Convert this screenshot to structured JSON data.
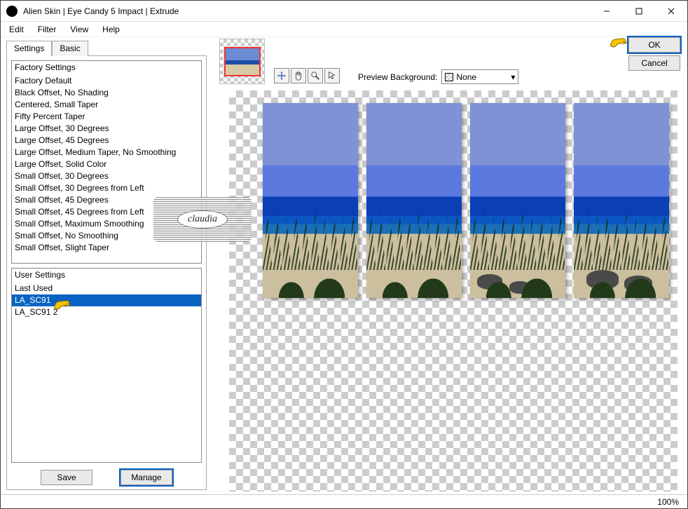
{
  "window": {
    "title": "Alien Skin | Eye Candy 5 Impact | Extrude"
  },
  "menu": {
    "edit": "Edit",
    "filter": "Filter",
    "view": "View",
    "help": "Help"
  },
  "tabs": {
    "settings": "Settings",
    "basic": "Basic"
  },
  "factory": {
    "header": "Factory Settings",
    "items": [
      "Factory Default",
      "Black Offset, No Shading",
      "Centered, Small Taper",
      "Fifty Percent Taper",
      "Large Offset, 30 Degrees",
      "Large Offset, 45 Degrees",
      "Large Offset, Medium Taper, No Smoothing",
      "Large Offset, Solid Color",
      "Small Offset, 30 Degrees",
      "Small Offset, 30 Degrees from Left",
      "Small Offset, 45 Degrees",
      "Small Offset, 45 Degrees from Left",
      "Small Offset, Maximum Smoothing",
      "Small Offset, No Smoothing",
      "Small Offset, Slight Taper"
    ]
  },
  "user": {
    "header": "User Settings",
    "items": [
      "Last Used",
      "LA_SC91",
      "LA_SC91 2"
    ],
    "selected_index": 1
  },
  "buttons": {
    "save": "Save",
    "manage": "Manage",
    "ok": "OK",
    "cancel": "Cancel"
  },
  "preview": {
    "bg_label": "Preview Background:",
    "bg_value": "None"
  },
  "status": {
    "zoom": "100%"
  },
  "watermark": {
    "text": "claudia"
  }
}
